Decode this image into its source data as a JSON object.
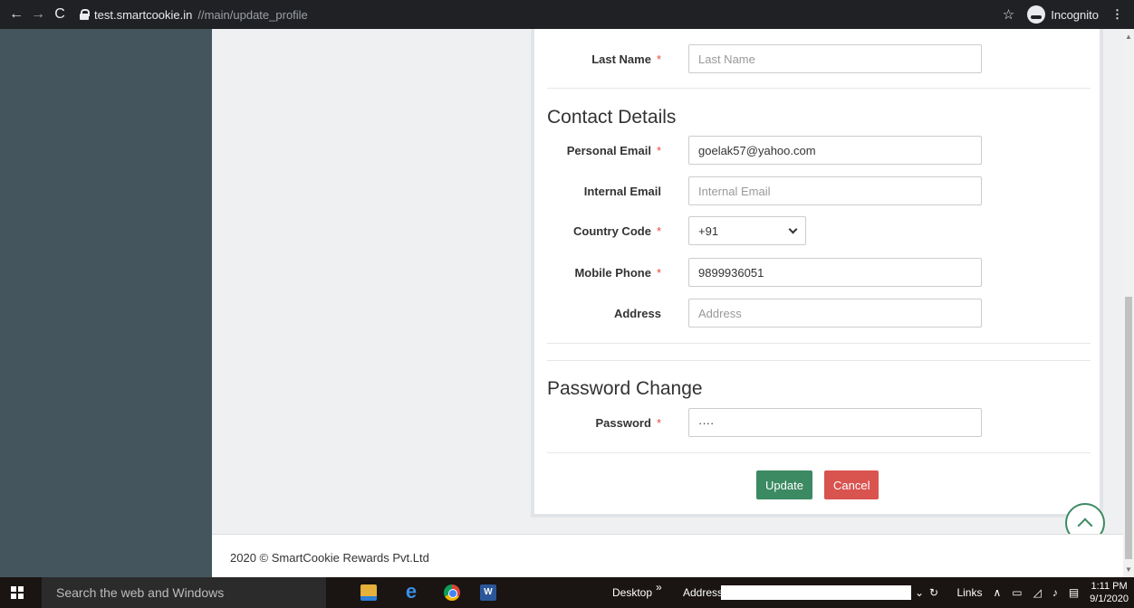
{
  "browser": {
    "url_host": "test.smartcookie.in",
    "url_path": "//main/update_profile",
    "incognito_label": "Incognito",
    "icons": [
      "back-arrow-icon",
      "forward-arrow-icon",
      "reload-icon",
      "lock-icon",
      "star-icon",
      "incognito-icon",
      "menu-dots-icon"
    ]
  },
  "form": {
    "last_name": {
      "label": "Last Name",
      "placeholder": "Last Name",
      "required": "*"
    },
    "contact_title": "Contact Details",
    "personal_email": {
      "label": "Personal Email",
      "value": "goelak57@yahoo.com",
      "required": "*"
    },
    "internal_email": {
      "label": "Internal Email",
      "placeholder": "Internal Email"
    },
    "country_code": {
      "label": "Country Code",
      "value": "+91",
      "required": "*"
    },
    "mobile_phone": {
      "label": "Mobile Phone",
      "value": "9899936051",
      "required": "*"
    },
    "address": {
      "label": "Address",
      "placeholder": "Address"
    },
    "password_title": "Password Change",
    "password": {
      "label": "Password",
      "value": "····",
      "required": "*"
    },
    "update_label": "Update",
    "cancel_label": "Cancel"
  },
  "footer": {
    "text": "2020 © SmartCookie Rewards Pvt.Ltd"
  },
  "taskbar": {
    "search_placeholder": "Search the web and Windows",
    "desktop_label": "Desktop",
    "chevron": "»",
    "address_label": "Address",
    "links_label": "Links",
    "time": "1:11 PM",
    "date": "9/1/2020"
  },
  "colors": {
    "accent": "#3c8a62",
    "danger": "#d9534f",
    "sidebar": "#44555e"
  }
}
